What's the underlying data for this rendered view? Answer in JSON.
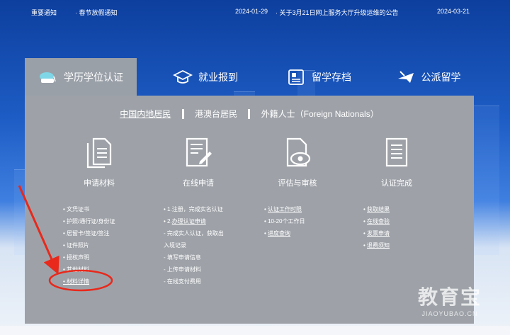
{
  "notices": {
    "left_label": "重要通知",
    "left_item": "· 春节放假通知",
    "left_date": "2024-01-29",
    "right_item": "· 关于3月21日网上服务大厅升级运维的公告",
    "right_date": "2024-03-21"
  },
  "tabs": [
    {
      "label": "学历学位认证",
      "icon": "graduation-cap-icon"
    },
    {
      "label": "就业报到",
      "icon": "mortarboard-icon"
    },
    {
      "label": "留学存档",
      "icon": "archive-card-icon"
    },
    {
      "label": "公派留学",
      "icon": "airplane-icon"
    }
  ],
  "regions": [
    "中国内地居民",
    "港澳台居民",
    "外籍人士（Foreign Nationals）"
  ],
  "steps": [
    {
      "label": "申请材料",
      "icon": "documents-icon"
    },
    {
      "label": "在线申请",
      "icon": "edit-form-icon"
    },
    {
      "label": "评估与审核",
      "icon": "eye-document-icon"
    },
    {
      "label": "认证完成",
      "icon": "checklist-icon"
    }
  ],
  "materials": [
    "• 文凭证书",
    "• 护照/通行证/身份证",
    "• 居留卡/签证/签注",
    "• 证件照片",
    "• 授权声明",
    "• 其他材料",
    "• 材料详情"
  ],
  "online": [
    "• 1.注册，完成实名认证",
    "• 2.",
    "办理认证申请",
    "- 完成实人认证，获取出",
    "入境记录",
    "- 填写申请信息",
    "- 上传申请材料",
    "- 在线支付费用"
  ],
  "review": [
    "• ",
    "认证工作时限",
    "• 10-20个工作日",
    "• ",
    "进度查询"
  ],
  "done": [
    "• ",
    "获取结果",
    "• ",
    "在线查验",
    "• ",
    "发票申请",
    "• ",
    "退费须知"
  ],
  "watermark": {
    "big": "教育宝",
    "small": "JIAOYUBAO.CN"
  },
  "colors": {
    "annotation": "#e8291c",
    "panel": "#9ea2a8",
    "bg_top": "#0d3f9e"
  }
}
